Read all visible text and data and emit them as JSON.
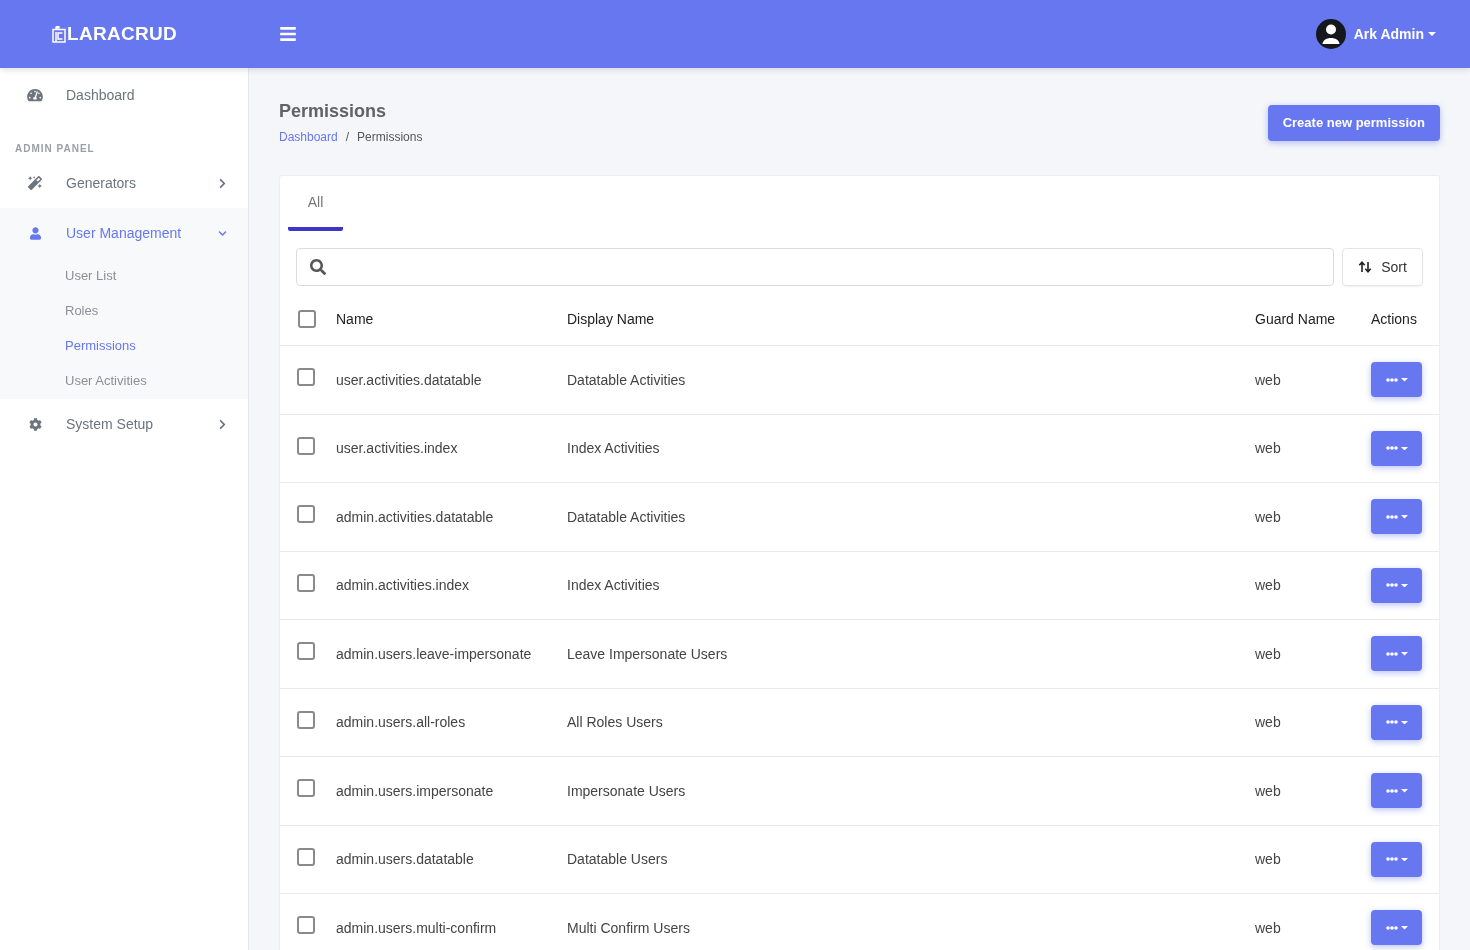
{
  "header": {
    "logo": "LARACRUD",
    "user_name": "Ark Admin"
  },
  "sidebar": {
    "items": [
      {
        "kind": "link",
        "label": "Dashboard",
        "selected": false
      },
      {
        "kind": "heading",
        "label": "ADMIN PANEL"
      },
      {
        "kind": "group",
        "label": "Generators",
        "selected": false,
        "expanded": false
      },
      {
        "kind": "group",
        "label": "User Management",
        "selected": true,
        "expanded": true,
        "children": [
          {
            "label": "User List",
            "selected": false
          },
          {
            "label": "Roles",
            "selected": false
          },
          {
            "label": "Permissions",
            "selected": true
          },
          {
            "label": "User Activities",
            "selected": false
          }
        ]
      },
      {
        "kind": "group",
        "label": "System Setup",
        "selected": false,
        "expanded": false
      }
    ]
  },
  "page": {
    "title": "Permissions",
    "breadcrumb": [
      {
        "kind": "link",
        "label": "Dashboard"
      },
      {
        "kind": "current",
        "label": "Permissions"
      }
    ],
    "breadcrumb_separator": "/",
    "create_button": "Create new permission"
  },
  "tabs": [
    {
      "label": "All",
      "selected": true
    }
  ],
  "toolbar": {
    "sort_button": "Sort"
  },
  "table": {
    "select_all_checked": false,
    "columns": [
      "Name",
      "Display Name",
      "Guard Name",
      "Actions"
    ],
    "rows": [
      {
        "name": "user.activities.datatable",
        "display_name": "Datatable Activities",
        "guard_name": "web",
        "checked": false
      },
      {
        "name": "user.activities.index",
        "display_name": "Index Activities",
        "guard_name": "web",
        "checked": false
      },
      {
        "name": "admin.activities.datatable",
        "display_name": "Datatable Activities",
        "guard_name": "web",
        "checked": false
      },
      {
        "name": "admin.activities.index",
        "display_name": "Index Activities",
        "guard_name": "web",
        "checked": false
      },
      {
        "name": "admin.users.leave-impersonate",
        "display_name": "Leave Impersonate Users",
        "guard_name": "web",
        "checked": false
      },
      {
        "name": "admin.users.all-roles",
        "display_name": "All Roles Users",
        "guard_name": "web",
        "checked": false
      },
      {
        "name": "admin.users.impersonate",
        "display_name": "Impersonate Users",
        "guard_name": "web",
        "checked": false
      },
      {
        "name": "admin.users.datatable",
        "display_name": "Datatable Users",
        "guard_name": "web",
        "checked": false
      },
      {
        "name": "admin.users.multi-confirm",
        "display_name": "Multi Confirm Users",
        "guard_name": "web",
        "checked": false
      }
    ]
  }
}
